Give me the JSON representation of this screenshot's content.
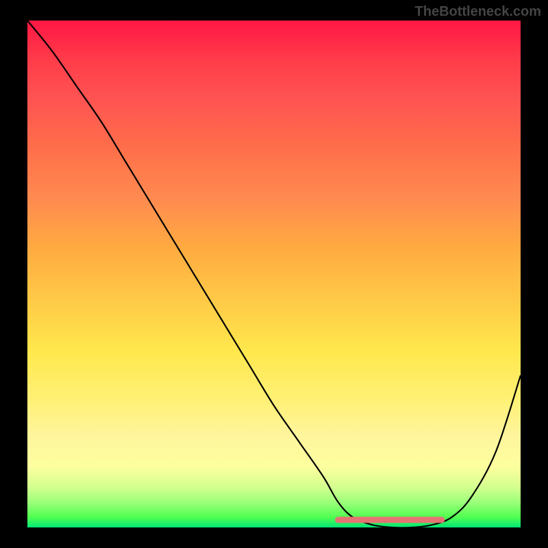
{
  "watermark": "TheBottleneck.com",
  "chart_data": {
    "type": "line",
    "title": "",
    "xlabel": "",
    "ylabel": "",
    "xlim": [
      0,
      100
    ],
    "ylim": [
      0,
      100
    ],
    "series": [
      {
        "name": "bottleneck-curve",
        "x": [
          0,
          5,
          10,
          15,
          20,
          25,
          30,
          35,
          40,
          45,
          50,
          55,
          60,
          63,
          66,
          70,
          74,
          78,
          82,
          86,
          90,
          95,
          100
        ],
        "y": [
          100,
          94,
          87,
          80,
          72,
          64,
          56,
          48,
          40,
          32,
          24,
          17,
          10,
          5,
          2,
          0.5,
          0,
          0,
          0.5,
          2,
          6,
          15,
          30
        ]
      },
      {
        "name": "highlight-band",
        "x": [
          63,
          84
        ],
        "y": [
          1.5,
          1.5
        ]
      }
    ],
    "gradient_stops": [
      {
        "pos": 0,
        "color": "#ff1744"
      },
      {
        "pos": 50,
        "color": "#ffc947"
      },
      {
        "pos": 85,
        "color": "#fff59d"
      },
      {
        "pos": 100,
        "color": "#00e676"
      }
    ]
  }
}
